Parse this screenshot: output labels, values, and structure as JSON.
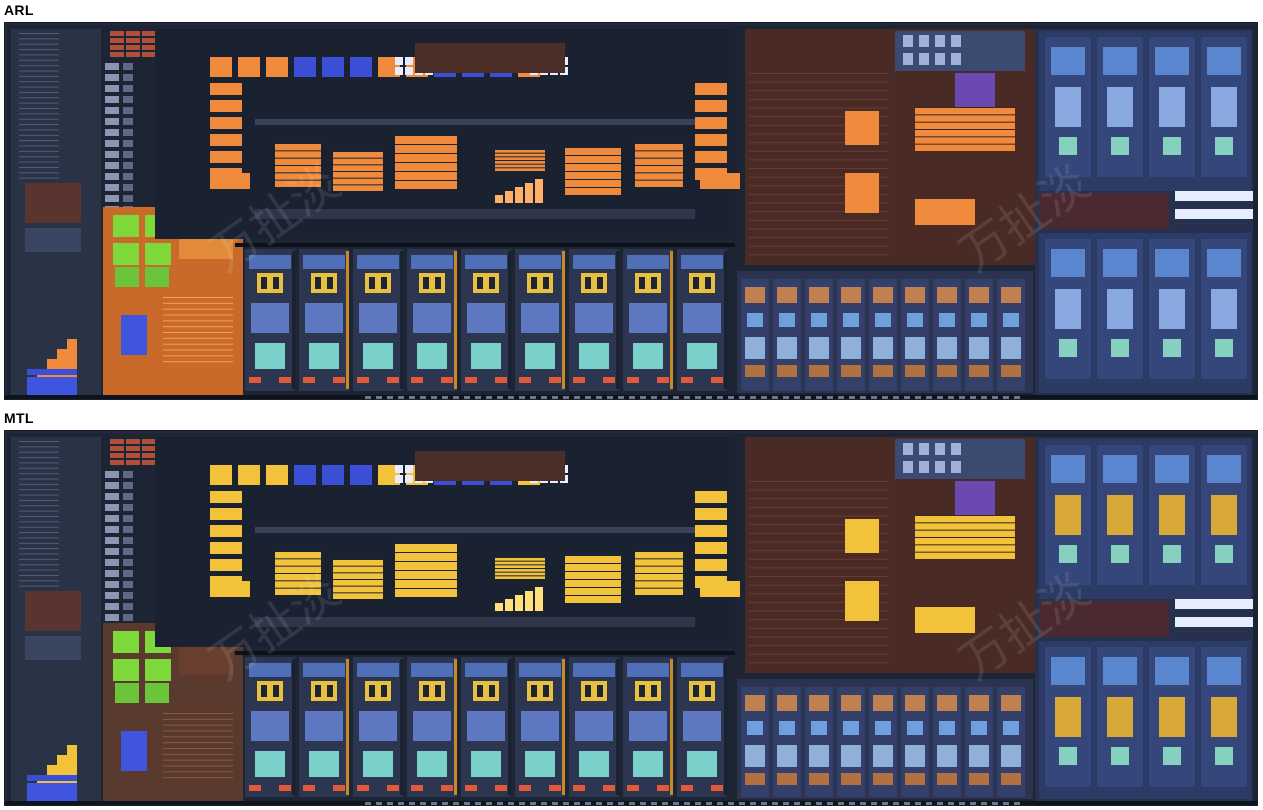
{
  "panels": [
    {
      "label": "ARL",
      "tint": "#f08a3c",
      "tint_light": "#ffb066",
      "variant": "arl"
    },
    {
      "label": "MTL",
      "tint": "#f2c23a",
      "tint_light": "#ffe07a",
      "variant": "mtl"
    }
  ],
  "watermark_text": "万扯淡",
  "colors": {
    "substrate": "#222b3d",
    "dark_block": "#141a26",
    "blue_cell": "#3b4fd6",
    "core_fill": "#39435e",
    "core_line": "#8ea0c8",
    "cache_brown": "#4a2a24",
    "green_tile": "#7ed83a",
    "gpu_fill": "#2c3a66"
  }
}
